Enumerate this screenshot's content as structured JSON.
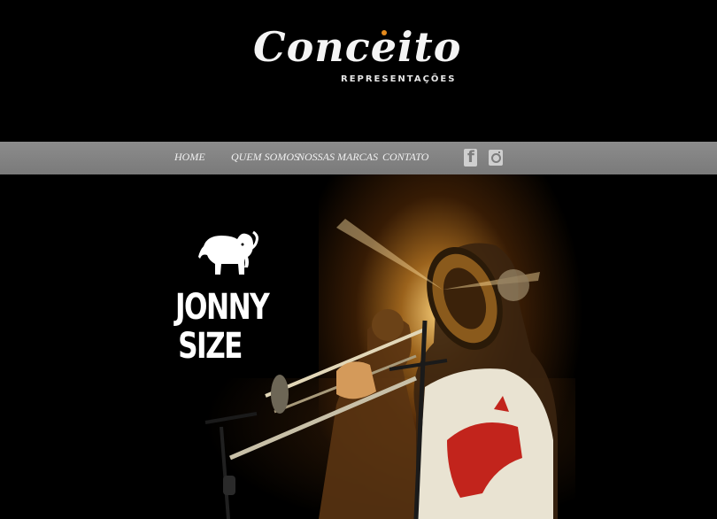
{
  "header": {
    "logo_title": "Conceito",
    "logo_subtitle": "REPRESENTAÇÕES"
  },
  "nav": {
    "items": [
      {
        "label": "HOME"
      },
      {
        "label": "QUEM SOMOS"
      },
      {
        "label": "NOSSAS MARCAS"
      },
      {
        "label": "CONTATO"
      }
    ],
    "social": [
      {
        "icon": "facebook-icon"
      },
      {
        "icon": "instagram-icon"
      }
    ]
  },
  "hero": {
    "brand_line1": "JONNY",
    "brand_line2": "SIZE"
  },
  "colors": {
    "background": "#000000",
    "navbar": "#828282",
    "accent": "#e58a1c",
    "hero_glow": "#ffcf78",
    "shirt_graphic": "#c2241c"
  }
}
